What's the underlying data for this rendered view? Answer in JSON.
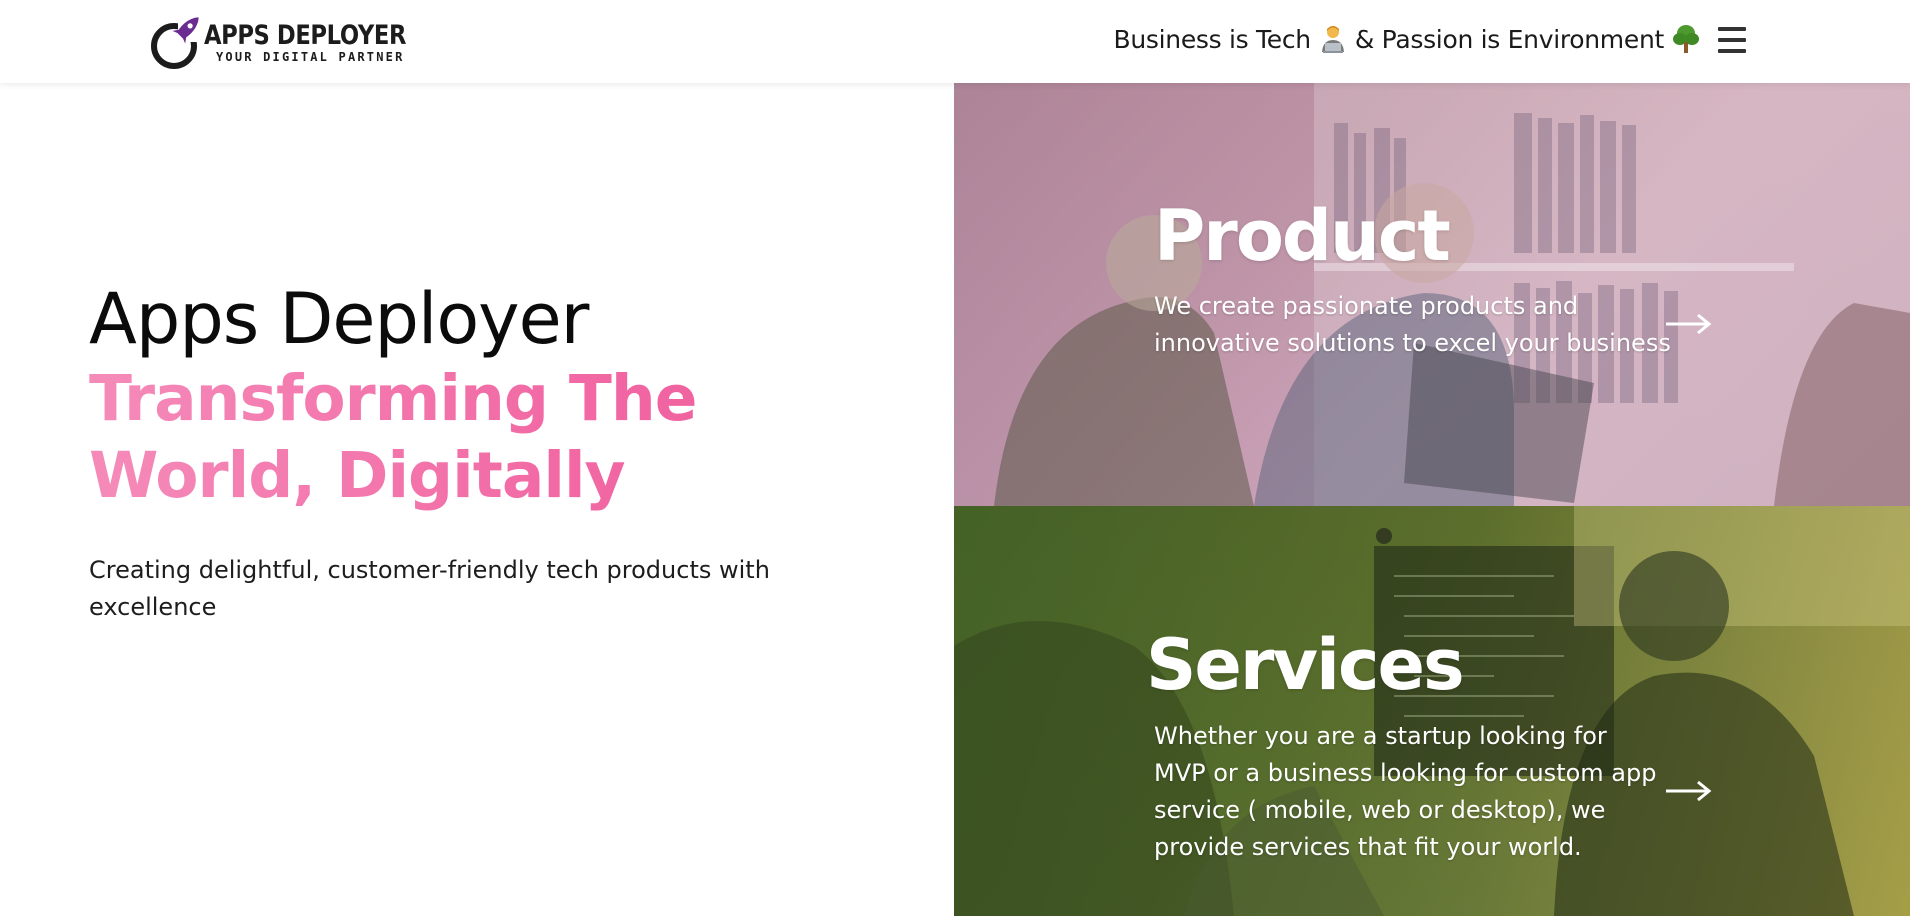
{
  "header": {
    "logo_title": "APPS DEPLOYER",
    "logo_tagline": "YOUR DIGITAL PARTNER",
    "tagline_part1": "Business is Tech",
    "tagline_part2": "& Passion is Environment",
    "icons": [
      "rocket-icon",
      "technologist-emoji-icon",
      "tree-emoji-icon",
      "hamburger-menu-icon"
    ]
  },
  "hero": {
    "title": "Apps Deployer",
    "subtitle": "Transforming The World, Digitally",
    "description": "Creating delightful, customer-friendly tech products with excellence"
  },
  "cards": {
    "product": {
      "title": "Product",
      "text": "We create passionate products and innovative solutions to excel your business",
      "arrow_icon": "arrow-right-icon"
    },
    "services": {
      "title": "Services",
      "text": "Whether you are a startup looking for MVP or a business looking for custom app service ( mobile, web or desktop), we provide services that fit your world.",
      "arrow_icon": "arrow-right-icon"
    }
  },
  "colors": {
    "accent_pink": "#f26aa5",
    "logo_purple": "#6b2c91",
    "product_overlay": "#d498b9",
    "services_overlay": "#4a6e28"
  }
}
